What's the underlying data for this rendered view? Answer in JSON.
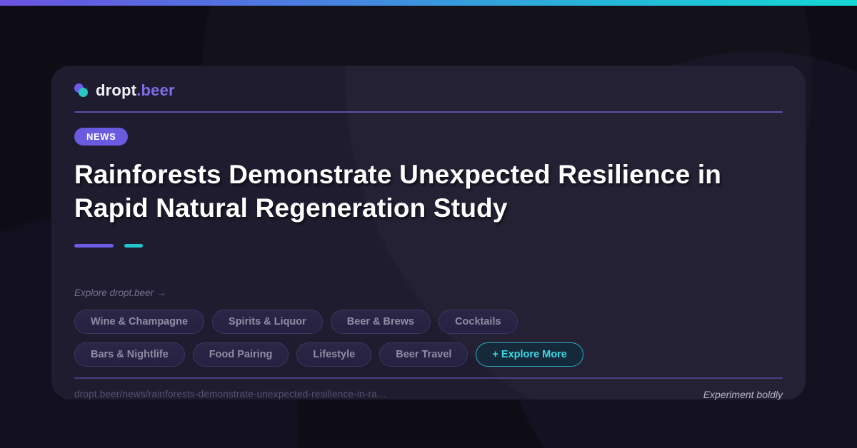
{
  "brand": {
    "name_primary": "dropt",
    "name_secondary": ".beer",
    "logo": "two-overlapping-circles"
  },
  "badge": {
    "label": "NEWS"
  },
  "headline": "Rainforests Demonstrate Unexpected Resilience in Rapid Natural Regeneration Study",
  "explore": {
    "label": "Explore dropt.beer →"
  },
  "categories": {
    "row1": [
      {
        "label": "Wine & Champagne"
      },
      {
        "label": "Spirits & Liquor"
      },
      {
        "label": "Beer & Brews"
      },
      {
        "label": "Cocktails"
      }
    ],
    "row2": [
      {
        "label": "Bars & Nightlife"
      },
      {
        "label": "Food Pairing"
      },
      {
        "label": "Lifestyle"
      },
      {
        "label": "Beer Travel"
      },
      {
        "label": "+ Explore More",
        "variant": "accent"
      }
    ]
  },
  "footer": {
    "url": "dropt.beer/news/rainforests-demonstrate-unexpected-resilience-in-ra…",
    "tagline": "Experiment boldly"
  },
  "colors": {
    "topbar_gradient_start": "#6a53e0",
    "topbar_gradient_end": "#14d8d4",
    "background": "#0e0c15",
    "card_background": "#201c30",
    "accent_purple": "#6c5ce7",
    "accent_teal": "#22c5ce",
    "badge_background": "#6a5ae0",
    "explore_more_text": "#38dce6",
    "pill_text": "#908ca4",
    "headline_text": "#ffffff"
  }
}
